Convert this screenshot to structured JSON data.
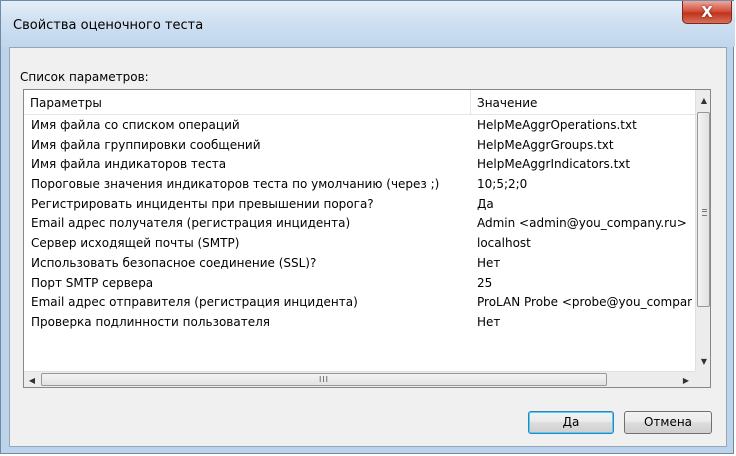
{
  "window": {
    "title": "Свойства оценочного теста",
    "close_label": "X"
  },
  "list": {
    "caption": "Список параметров:",
    "columns": [
      "Параметры",
      "Значение"
    ],
    "rows": [
      [
        "Имя файла со списком операций",
        "HelpMeAggrOperations.txt"
      ],
      [
        "Имя файла группировки сообщений",
        "HelpMeAggrGroups.txt"
      ],
      [
        "Имя файла индикаторов теста",
        "HelpMeAggrIndicators.txt"
      ],
      [
        "Пороговые значения индикаторов теста по умолчанию (через ;)",
        "10;5;2;0"
      ],
      [
        "Регистрировать инциденты при превышении порога?",
        "Да"
      ],
      [
        "Email адрес получателя (регистрация инцидента)",
        "Admin <admin@you_company.ru>"
      ],
      [
        "Сервер исходящей почты (SMTP)",
        "localhost"
      ],
      [
        "Использовать безопасное соединение (SSL)?",
        "Нет"
      ],
      [
        "Порт SMTP сервера",
        "25"
      ],
      [
        "Email адрес отправителя (регистрация инцидента)",
        "ProLAN Probe <probe@you_company.ru>"
      ],
      [
        "Проверка подлинности пользователя",
        "Нет"
      ]
    ],
    "hscroll_grip": "III"
  },
  "buttons": {
    "ok_label": "Да",
    "cancel_label": "Отмена"
  },
  "icons": {
    "close": "close-icon",
    "scroll_up": "scroll-up-arrow-icon",
    "scroll_down": "scroll-down-arrow-icon",
    "scroll_left": "scroll-left-arrow-icon",
    "scroll_right": "scroll-right-arrow-icon"
  },
  "colors": {
    "frame": "#bcd3ea",
    "close_button": "#c2331c",
    "default_button_border": "#3c7fb1"
  }
}
